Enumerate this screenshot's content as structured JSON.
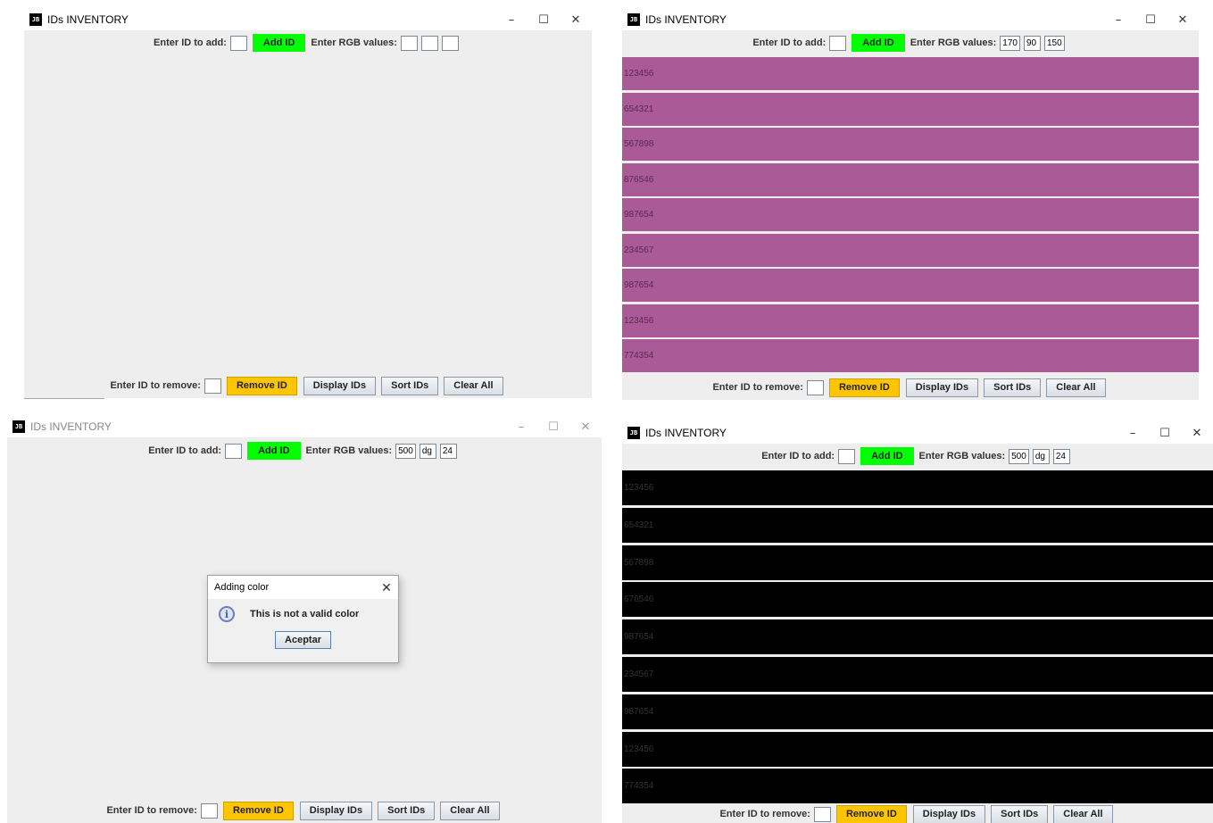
{
  "app_title": "IDs INVENTORY",
  "controls": {
    "add_label": "Enter ID to add:",
    "add_button": "Add ID",
    "rgb_label": "Enter RGB values:",
    "remove_label": "Enter ID to remove:",
    "remove_button": "Remove ID",
    "display_button": "Display IDs",
    "sort_button": "Sort IDs",
    "clear_button": "Clear All"
  },
  "window_controls": {
    "minimize": "–",
    "maximize": "☐",
    "close": "✕"
  },
  "panel2": {
    "rgb": [
      "170",
      "90",
      "150"
    ],
    "row_color": "#aa5a96",
    "ids": [
      "123456",
      "654321",
      "567898",
      "876546",
      "987654",
      "234567",
      "987654",
      "123456",
      "774354"
    ]
  },
  "panel3": {
    "rgb": [
      "500",
      "dg",
      "24"
    ],
    "dialog": {
      "title": "Adding color",
      "message": "This is not a valid color",
      "button": "Aceptar",
      "icon": "info-icon",
      "icon_glyph": "i"
    }
  },
  "panel4": {
    "rgb": [
      "500",
      "dg",
      "24"
    ],
    "row_color": "#000000",
    "ids": [
      "123456",
      "654321",
      "567898",
      "676546",
      "987654",
      "234567",
      "987654",
      "123456",
      "774354"
    ]
  },
  "colors": {
    "add_button": "#00ff00",
    "remove_button": "#ffc500",
    "window_bg": "#eeeeee"
  }
}
